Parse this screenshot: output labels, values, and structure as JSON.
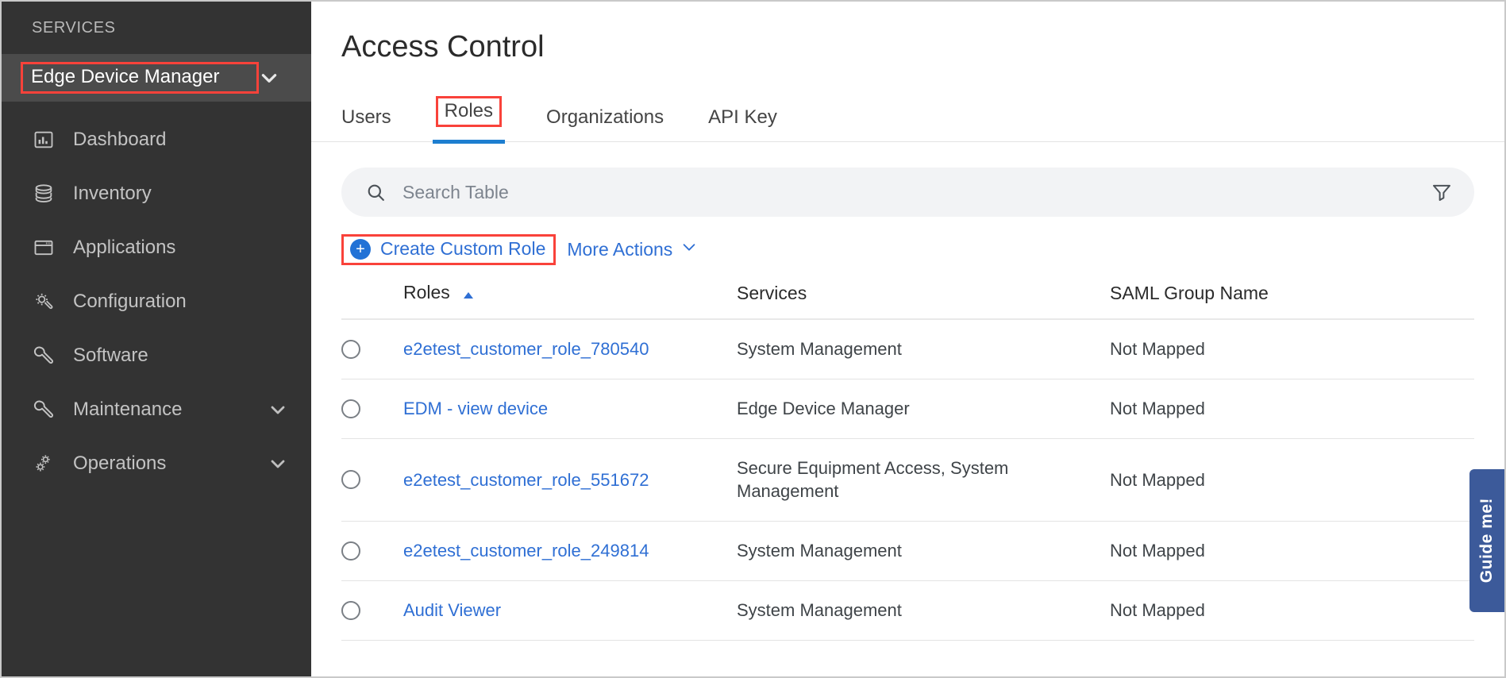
{
  "sidebar": {
    "section_label": "SERVICES",
    "service_selector": {
      "label": "Edge Device Manager",
      "chevron_icon": "chevron-down-icon",
      "highlight_color": "#f9423a"
    },
    "items": [
      {
        "label": "Dashboard",
        "icon": "bar-chart-icon",
        "has_chevron": false
      },
      {
        "label": "Inventory",
        "icon": "database-icon",
        "has_chevron": false
      },
      {
        "label": "Applications",
        "icon": "window-icon",
        "has_chevron": false
      },
      {
        "label": "Configuration",
        "icon": "gear-wrench-icon",
        "has_chevron": false
      },
      {
        "label": "Software",
        "icon": "wrench-icon",
        "has_chevron": false
      },
      {
        "label": "Maintenance",
        "icon": "wrench-icon",
        "has_chevron": true
      },
      {
        "label": "Operations",
        "icon": "gears-icon",
        "has_chevron": true
      }
    ]
  },
  "main": {
    "page_title": "Access Control",
    "tabs": [
      {
        "label": "Users",
        "active": false,
        "highlighted": false
      },
      {
        "label": "Roles",
        "active": true,
        "highlighted": true
      },
      {
        "label": "Organizations",
        "active": false,
        "highlighted": false
      },
      {
        "label": "API Key",
        "active": false,
        "highlighted": false
      }
    ],
    "active_tab_underline_color": "#1d7ed0",
    "search": {
      "placeholder": "Search Table",
      "value": "",
      "search_icon": "search-icon",
      "filter_icon": "filter-icon"
    },
    "actions": {
      "create_label": "Create Custom Role",
      "create_icon": "plus-circle-icon",
      "more_actions_label": "More Actions",
      "more_actions_icon": "chevron-down-icon",
      "link_color": "#2f6fd4",
      "highlight_color": "#f9423a"
    },
    "table": {
      "columns": [
        "Roles",
        "Services",
        "SAML Group Name"
      ],
      "sorted_column": "Roles",
      "sort_direction": "asc",
      "sort_icon": "caret-up-icon",
      "rows": [
        {
          "selected": false,
          "role": "e2etest_customer_role_780540",
          "services": "System Management",
          "saml_group_name": "Not Mapped"
        },
        {
          "selected": false,
          "role": "EDM - view device",
          "services": "Edge Device Manager",
          "saml_group_name": "Not Mapped"
        },
        {
          "selected": false,
          "role": "e2etest_customer_role_551672",
          "services": "Secure Equipment Access, System Management",
          "saml_group_name": "Not Mapped"
        },
        {
          "selected": false,
          "role": "e2etest_customer_role_249814",
          "services": "System Management",
          "saml_group_name": "Not Mapped"
        },
        {
          "selected": false,
          "role": "Audit Viewer",
          "services": "System Management",
          "saml_group_name": "Not Mapped"
        }
      ]
    }
  },
  "guide_me": {
    "label": "Guide me!",
    "color": "#3c5a9a"
  }
}
